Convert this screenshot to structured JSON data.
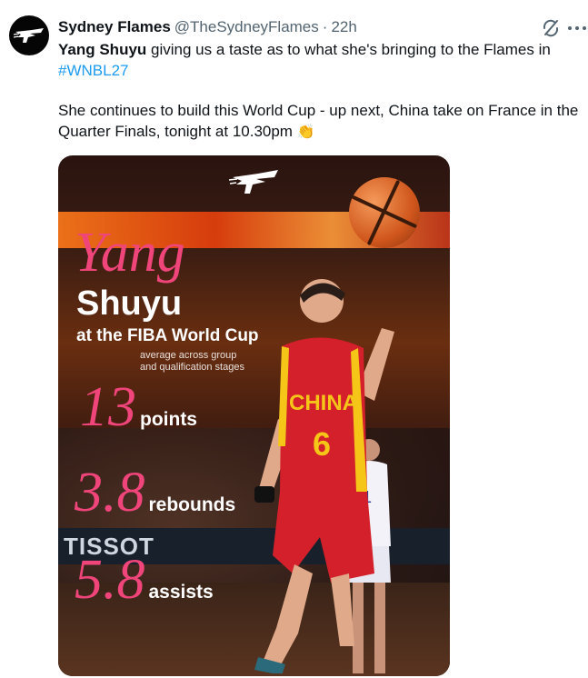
{
  "author": {
    "display_name": "Sydney Flames",
    "handle": "@TheSydneyFlames",
    "separator": "·",
    "time": "22h"
  },
  "tweet": {
    "bold_name": "Yang Shuyu",
    "line1_rest": " giving us a taste as to what she's bringing to the Flames in",
    "hashtag": "#WNBL27",
    "paragraph2": "She continues to build this World Cup - up next, China take on France in the Quarter Finals, tonight at 10.30pm",
    "emoji": "👏"
  },
  "graphic": {
    "first_name": "Yang",
    "last_name": "Shuyu",
    "subtitle": "at the FIBA World Cup",
    "note_line1": "average across group",
    "note_line2": "and qualification stages",
    "stats": [
      {
        "value": "13",
        "label": "points"
      },
      {
        "value": "3.8",
        "label": "rebounds"
      },
      {
        "value": "5.8",
        "label": "assists"
      }
    ],
    "jersey_text": "CHINA",
    "jersey_number": "6",
    "sponsor_text": "TISSOT"
  },
  "colors": {
    "accent_pink": "#f0457a",
    "link_blue": "#1d9bf0",
    "muted_gray": "#536471",
    "jersey_red": "#d4202a",
    "jersey_gold": "#f5c518"
  },
  "icons": {
    "grok": "grok-icon",
    "more": "more-options-icon",
    "avatar": "flames-logo"
  }
}
